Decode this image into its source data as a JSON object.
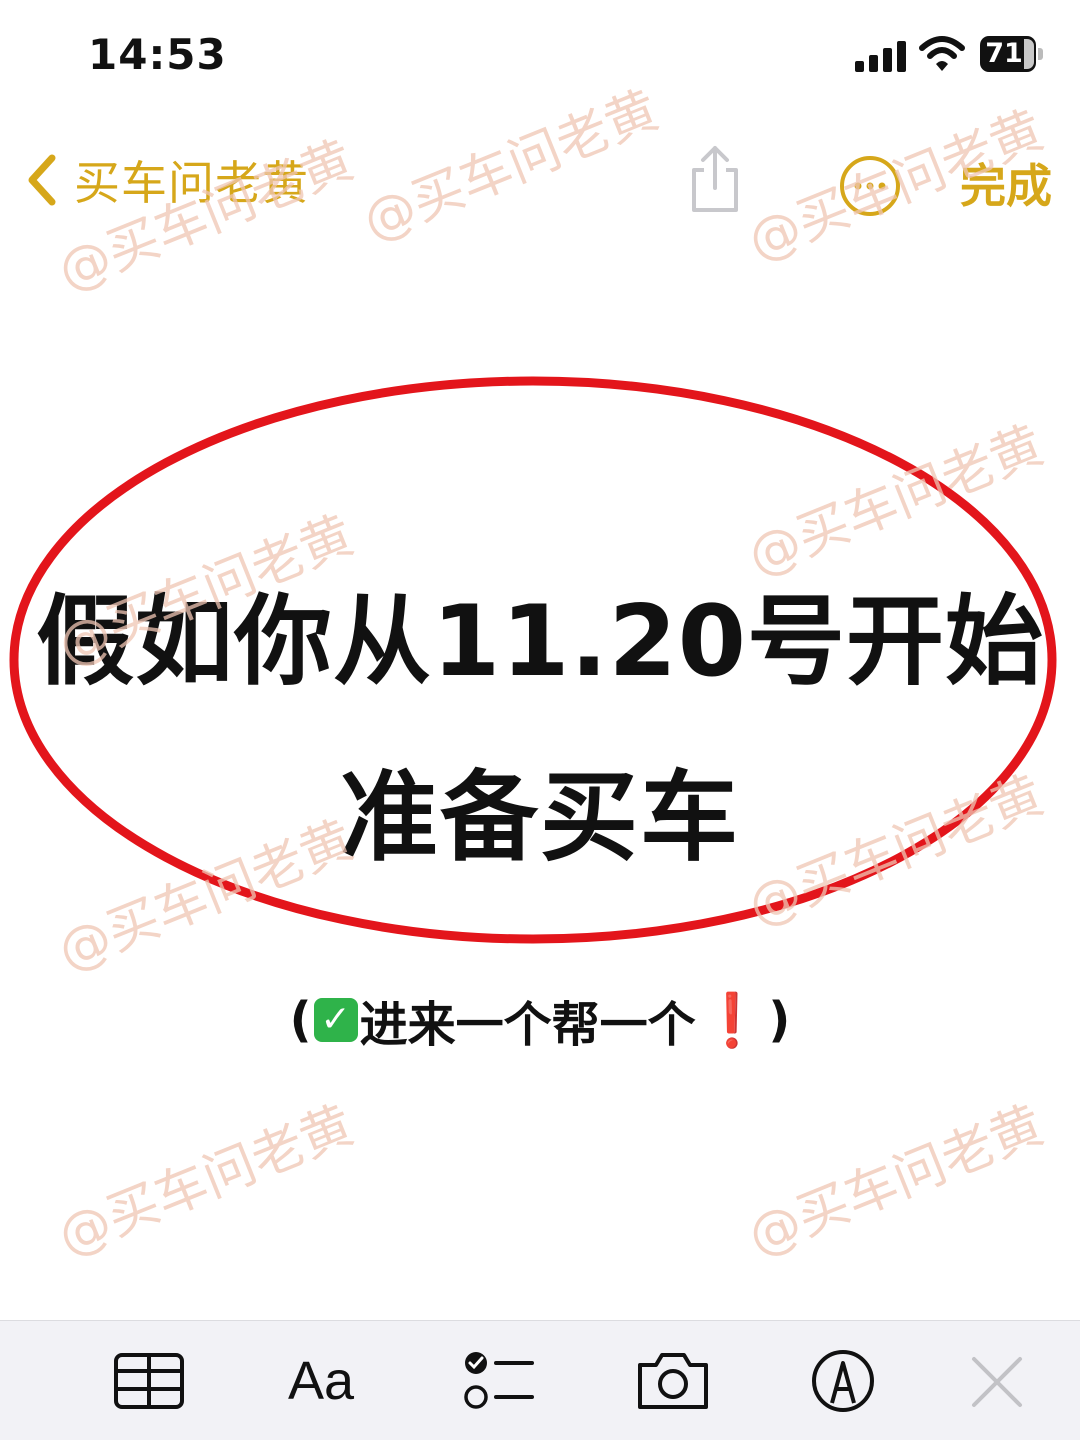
{
  "status_bar": {
    "time": "14:53",
    "battery": "71"
  },
  "nav": {
    "back_label": "买车问老黄",
    "done_label": "完成"
  },
  "note": {
    "headline_line1": "假如你从11.20号开始",
    "headline_line2": "准备买车",
    "subtitle_open": "(",
    "subtitle_check": "✓",
    "subtitle_text": "进来一个帮一个",
    "subtitle_exclaim": "❗",
    "subtitle_close": ")"
  },
  "watermark": "@买车问老黄",
  "toolbar": {
    "format_label": "Aa",
    "icons": [
      "table-icon",
      "format-text-icon",
      "checklist-icon",
      "camera-icon",
      "markup-pen-icon",
      "close-icon"
    ]
  },
  "colors": {
    "accent": "#d6a71a",
    "ellipse": "#e3151b",
    "watermark": "#f0c6b4",
    "toolbar_bg": "#f2f2f6"
  }
}
